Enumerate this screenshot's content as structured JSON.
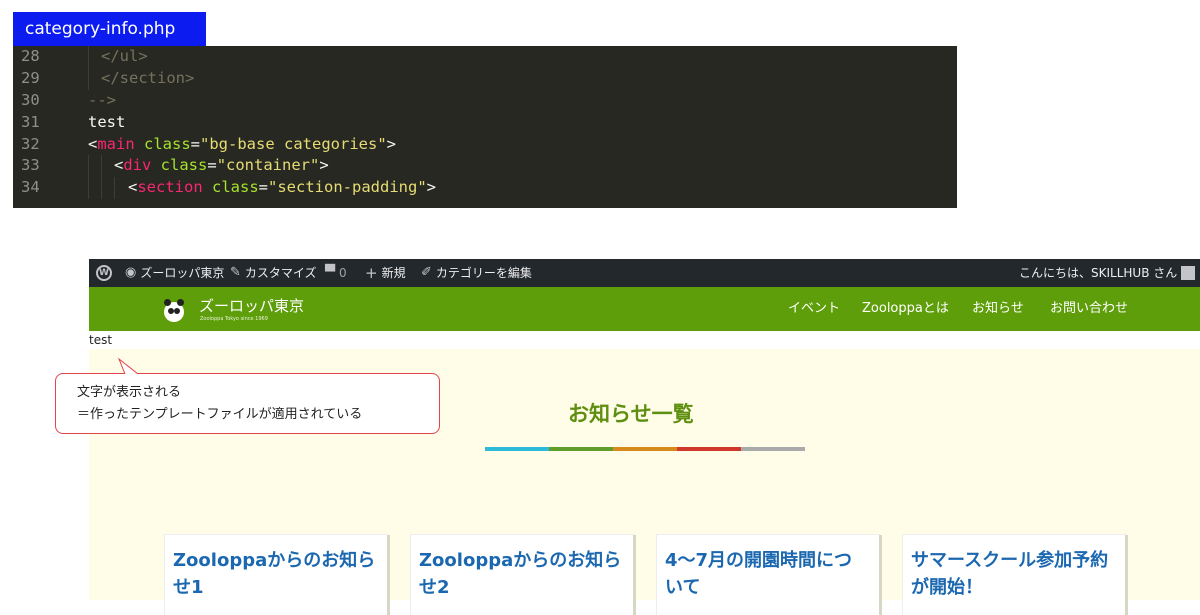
{
  "editor": {
    "filename": "category-info.php",
    "lines": [
      {
        "num": "28",
        "parts": [
          {
            "t": "</ul>",
            "c": "dim"
          }
        ]
      },
      {
        "num": "29",
        "parts": [
          {
            "t": "</section>",
            "c": "dim"
          }
        ]
      },
      {
        "num": "30",
        "parts": [
          {
            "t": "-->",
            "c": "dim"
          }
        ]
      },
      {
        "num": "31",
        "parts": [
          {
            "t": "test",
            "c": "plain"
          }
        ]
      },
      {
        "num": "32",
        "parts": [
          {
            "t": "<",
            "c": "plain"
          },
          {
            "t": "main",
            "c": "tag"
          },
          {
            "t": " class",
            "c": "attr"
          },
          {
            "t": "=",
            "c": "plain"
          },
          {
            "t": "\"bg-base categories\"",
            "c": "str"
          },
          {
            "t": ">",
            "c": "plain"
          }
        ]
      },
      {
        "num": "33",
        "parts": [
          {
            "t": "<",
            "c": "plain"
          },
          {
            "t": "div",
            "c": "tag"
          },
          {
            "t": " class",
            "c": "attr"
          },
          {
            "t": "=",
            "c": "plain"
          },
          {
            "t": "\"container\"",
            "c": "str"
          },
          {
            "t": ">",
            "c": "plain"
          }
        ]
      },
      {
        "num": "34",
        "parts": [
          {
            "t": "<",
            "c": "plain"
          },
          {
            "t": "section",
            "c": "tag"
          },
          {
            "t": " class",
            "c": "attr"
          },
          {
            "t": "=",
            "c": "plain"
          },
          {
            "t": "\"section-padding\"",
            "c": "str"
          },
          {
            "t": ">",
            "c": "plain"
          }
        ]
      }
    ]
  },
  "adminbar": {
    "site_name": "ズーロッパ東京",
    "customize": "カスタマイズ",
    "comments_count": "0",
    "new_label": "新規",
    "edit_category": "カテゴリーを編集",
    "greeting": "こんにちは、SKILLHUB さん"
  },
  "site": {
    "title": "ズーロッパ東京",
    "tagline": "Zooloppa Tokyo since 1969",
    "nav": [
      "イベント",
      "Zooloppaとは",
      "お知らせ",
      "お問い合わせ"
    ]
  },
  "page": {
    "test_text": "test",
    "section_title": "お知らせ一覧",
    "color_bar": [
      "#2bbbd8",
      "#5f9e2a",
      "#d68a1b",
      "#d0382b",
      "#aaaaaa"
    ],
    "cards": [
      "Zooloppaからのお知らせ1",
      "Zooloppaからのお知らせ2",
      "4〜7月の開園時間について",
      "サマースクール参加予約が開始！"
    ]
  },
  "callout": {
    "line1": "文字が表示される",
    "line2": "＝作ったテンプレートファイルが適用されている"
  },
  "colors": {
    "editor_bg": "#272822",
    "header_green": "#5f9e0b",
    "title_green": "#5f8f10",
    "card_blue": "#1b68b0",
    "callout_border": "#e3434b",
    "file_tab": "#0c1cf0"
  }
}
